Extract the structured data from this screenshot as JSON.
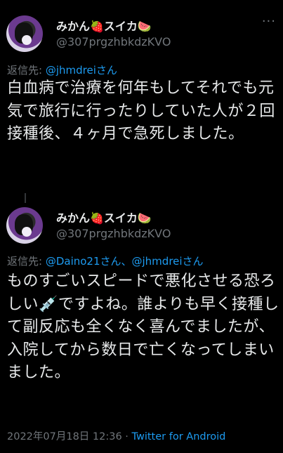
{
  "tweets": [
    {
      "display_name": "みかん🍓スイカ🍉",
      "handle": "@307prgzhbkdzKVO",
      "more_icon": "more-dots-icon",
      "reply_prefix": "返信先: ",
      "reply_to": "@jhmdreiさん",
      "text": "白血病で治療を何年もしてそれでも元気で旅行に行ったりしていた人が２回接種後、４ヶ月で急死しました。"
    },
    {
      "display_name": "みかん🍓スイカ🍉",
      "handle": "@307prgzhbkdzKVO",
      "more_icon": "more-dots-icon",
      "reply_prefix": "返信先: ",
      "reply_to": "@Daino21さん、@jhmdreiさん",
      "text": "ものすごいスピードで悪化させる恐ろしい💉ですよね。誰よりも早く接種して副反応も全くなく喜んでましたが、入院してから数日で亡くなってしまいました。",
      "timestamp": "2022年07月18日 12:36",
      "separator": " · ",
      "source": "Twitter for Android"
    }
  ]
}
